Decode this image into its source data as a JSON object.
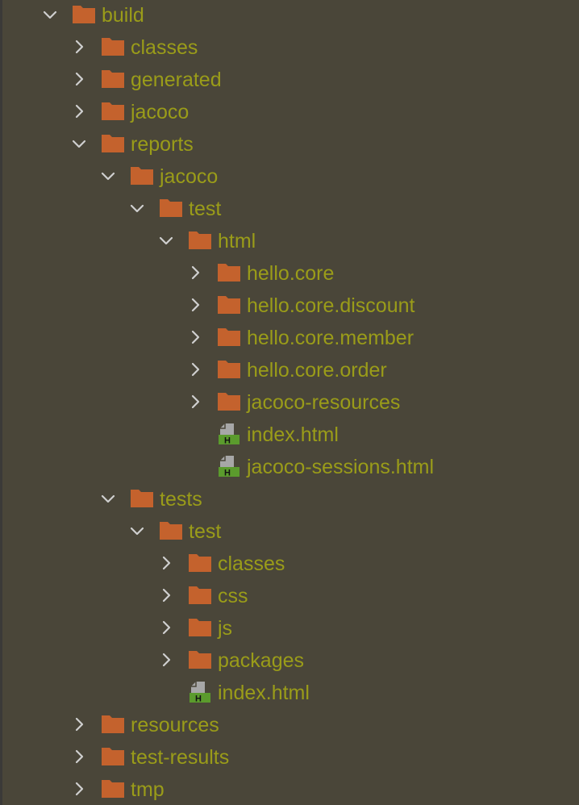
{
  "tree": {
    "colors": {
      "background": "#4a4639",
      "text": "#9a9c19",
      "folder": "#c4622d",
      "chevron": "#cfcfcf",
      "file_badge": "#5b9b2d"
    },
    "items": [
      {
        "label": "build",
        "kind": "folder",
        "expanded": true,
        "depth": 0
      },
      {
        "label": "classes",
        "kind": "folder",
        "expanded": false,
        "depth": 1
      },
      {
        "label": "generated",
        "kind": "folder",
        "expanded": false,
        "depth": 1
      },
      {
        "label": "jacoco",
        "kind": "folder",
        "expanded": false,
        "depth": 1
      },
      {
        "label": "reports",
        "kind": "folder",
        "expanded": true,
        "depth": 1
      },
      {
        "label": "jacoco",
        "kind": "folder",
        "expanded": true,
        "depth": 2
      },
      {
        "label": "test",
        "kind": "folder",
        "expanded": true,
        "depth": 3
      },
      {
        "label": "html",
        "kind": "folder",
        "expanded": true,
        "depth": 4
      },
      {
        "label": "hello.core",
        "kind": "folder",
        "expanded": false,
        "depth": 5
      },
      {
        "label": "hello.core.discount",
        "kind": "folder",
        "expanded": false,
        "depth": 5
      },
      {
        "label": "hello.core.member",
        "kind": "folder",
        "expanded": false,
        "depth": 5
      },
      {
        "label": "hello.core.order",
        "kind": "folder",
        "expanded": false,
        "depth": 5
      },
      {
        "label": "jacoco-resources",
        "kind": "folder",
        "expanded": false,
        "depth": 5
      },
      {
        "label": "index.html",
        "kind": "html-file",
        "depth": 5
      },
      {
        "label": "jacoco-sessions.html",
        "kind": "html-file",
        "depth": 5
      },
      {
        "label": "tests",
        "kind": "folder",
        "expanded": true,
        "depth": 2
      },
      {
        "label": "test",
        "kind": "folder",
        "expanded": true,
        "depth": 3
      },
      {
        "label": "classes",
        "kind": "folder",
        "expanded": false,
        "depth": 4
      },
      {
        "label": "css",
        "kind": "folder",
        "expanded": false,
        "depth": 4
      },
      {
        "label": "js",
        "kind": "folder",
        "expanded": false,
        "depth": 4
      },
      {
        "label": "packages",
        "kind": "folder",
        "expanded": false,
        "depth": 4
      },
      {
        "label": "index.html",
        "kind": "html-file",
        "depth": 4
      },
      {
        "label": "resources",
        "kind": "folder",
        "expanded": false,
        "depth": 1
      },
      {
        "label": "test-results",
        "kind": "folder",
        "expanded": false,
        "depth": 1
      },
      {
        "label": "tmp",
        "kind": "folder",
        "expanded": false,
        "depth": 1
      }
    ]
  }
}
